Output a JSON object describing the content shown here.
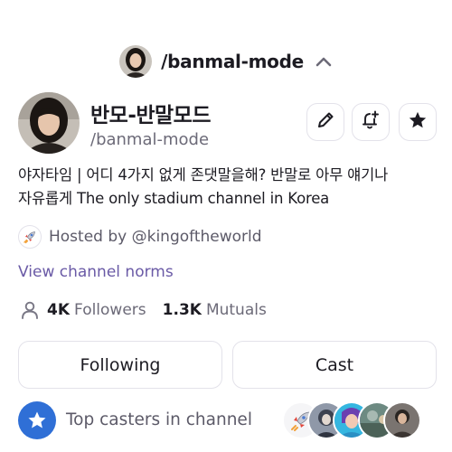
{
  "header": {
    "title": "/banmal-mode",
    "avatar_icon": "channel-avatar",
    "toggle_icon": "chevron-up-icon"
  },
  "channel": {
    "name": "반모-반말모드",
    "handle": "/banmal-mode",
    "bio_line1": "야자타임 | 어디 4가지 없게 존댓말을해? 반말로 아무 얘기나",
    "bio_line2": "자유롭게 The only stadium channel in Korea"
  },
  "actions": {
    "edit_icon": "pencil-icon",
    "notify_icon": "bell-plus-icon",
    "favorite_icon": "star-icon"
  },
  "host": {
    "label": "Hosted by @kingoftheworld",
    "icon": "rocket-icon"
  },
  "norms_link": "View channel norms",
  "stats": {
    "followers_count": "4K",
    "followers_label": "Followers",
    "mutuals_count": "1.3K",
    "mutuals_label": "Mutuals"
  },
  "buttons": {
    "following": "Following",
    "cast": "Cast"
  },
  "top_casters": {
    "label": "Top casters in channel",
    "avatars": [
      "rocket-avatar",
      "anime-avatar",
      "game-character-avatar",
      "photo-avatar",
      "person-avatar"
    ]
  },
  "colors": {
    "accent_link": "#6a5aa6",
    "star_badge": "#2f6fd6",
    "border": "#e3e2ea"
  }
}
